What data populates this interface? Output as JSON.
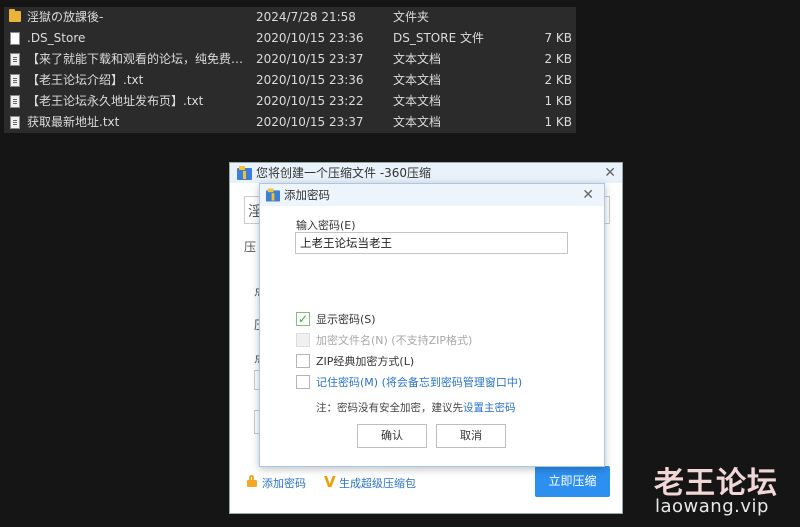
{
  "files": [
    {
      "name": "淫獄の放課後-",
      "date": "2024/7/28 21:58",
      "type": "文件夹",
      "size": "",
      "icon": "folder-icon"
    },
    {
      "name": ".DS_Store",
      "date": "2020/10/15 23:36",
      "type": "DS_STORE 文件",
      "size": "7 KB",
      "icon": "file-icon"
    },
    {
      "name": "【来了就能下载和观看的论坛，纯免费！...",
      "date": "2020/10/15 23:37",
      "type": "文本文档",
      "size": "2 KB",
      "icon": "text-file-icon"
    },
    {
      "name": "【老王论坛介绍】.txt",
      "date": "2020/10/15 23:36",
      "type": "文本文档",
      "size": "2 KB",
      "icon": "text-file-icon"
    },
    {
      "name": "【老王论坛永久地址发布页】.txt",
      "date": "2020/10/15 23:22",
      "type": "文本文档",
      "size": "1 KB",
      "icon": "text-file-icon"
    },
    {
      "name": "获取最新地址.txt",
      "date": "2020/10/15 23:37",
      "type": "文本文档",
      "size": "1 KB",
      "icon": "text-file-icon"
    }
  ],
  "main_dialog": {
    "title": "您将创建一个压缩文件 -360压缩",
    "close": "✕",
    "bg_chars": [
      "淫",
      "压",
      "点",
      "压",
      "点"
    ],
    "add_password": "添加密码",
    "super_package": "生成超级压缩包",
    "compress_now": "立即压缩"
  },
  "password_dialog": {
    "title": "添加密码",
    "close": "✕",
    "input_label": "输入密码(E)",
    "password_value": "上老王论坛当老王",
    "options": {
      "show_password": "显示密码(S)",
      "encrypt_names": "加密文件名(N) (不支持ZIP格式)",
      "zip_classic": "ZIP经典加密方式(L)",
      "remember": "记住密码(M) (将会备忘到密码管理窗口中)"
    },
    "show_password_checked": true,
    "note_prefix": "注：密码没有安全加密，建议先",
    "note_link": "设置主密码",
    "ok": "确认",
    "cancel": "取消"
  },
  "watermark": {
    "title": "老王论坛",
    "url": "laowang.vip"
  },
  "colors": {
    "accent": "#2d8ff0",
    "link": "#2a73c9",
    "folder": "#e9b43a",
    "background": "#151515"
  }
}
